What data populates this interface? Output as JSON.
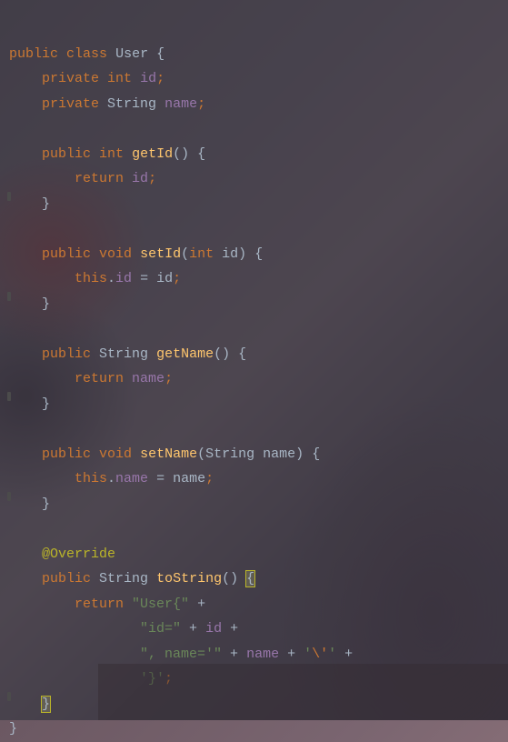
{
  "code": {
    "tokens": {
      "public": "public",
      "class": "class",
      "private": "private",
      "return": "return",
      "this": "this",
      "void": "void",
      "int": "int",
      "String": "String",
      "User": "User",
      "id": "id",
      "name": "name",
      "getId": "getId",
      "setId": "setId",
      "getName": "getName",
      "setName": "setName",
      "toString": "toString",
      "Override": "@Override"
    },
    "strings": {
      "userOpen": "\"User{\"",
      "idEq": "\"id=\"",
      "nameEq": "\", name='\"",
      "escQuote": "'\\''",
      "closeBrace": "'}'"
    },
    "punct": {
      "space": " ",
      "openParen": "(",
      "closeParen": ")",
      "openBrace": "{",
      "closeBrace": "}",
      "semi": ";",
      "dot": ".",
      "equals": " = ",
      "plus": " + ",
      "comma": ","
    }
  }
}
